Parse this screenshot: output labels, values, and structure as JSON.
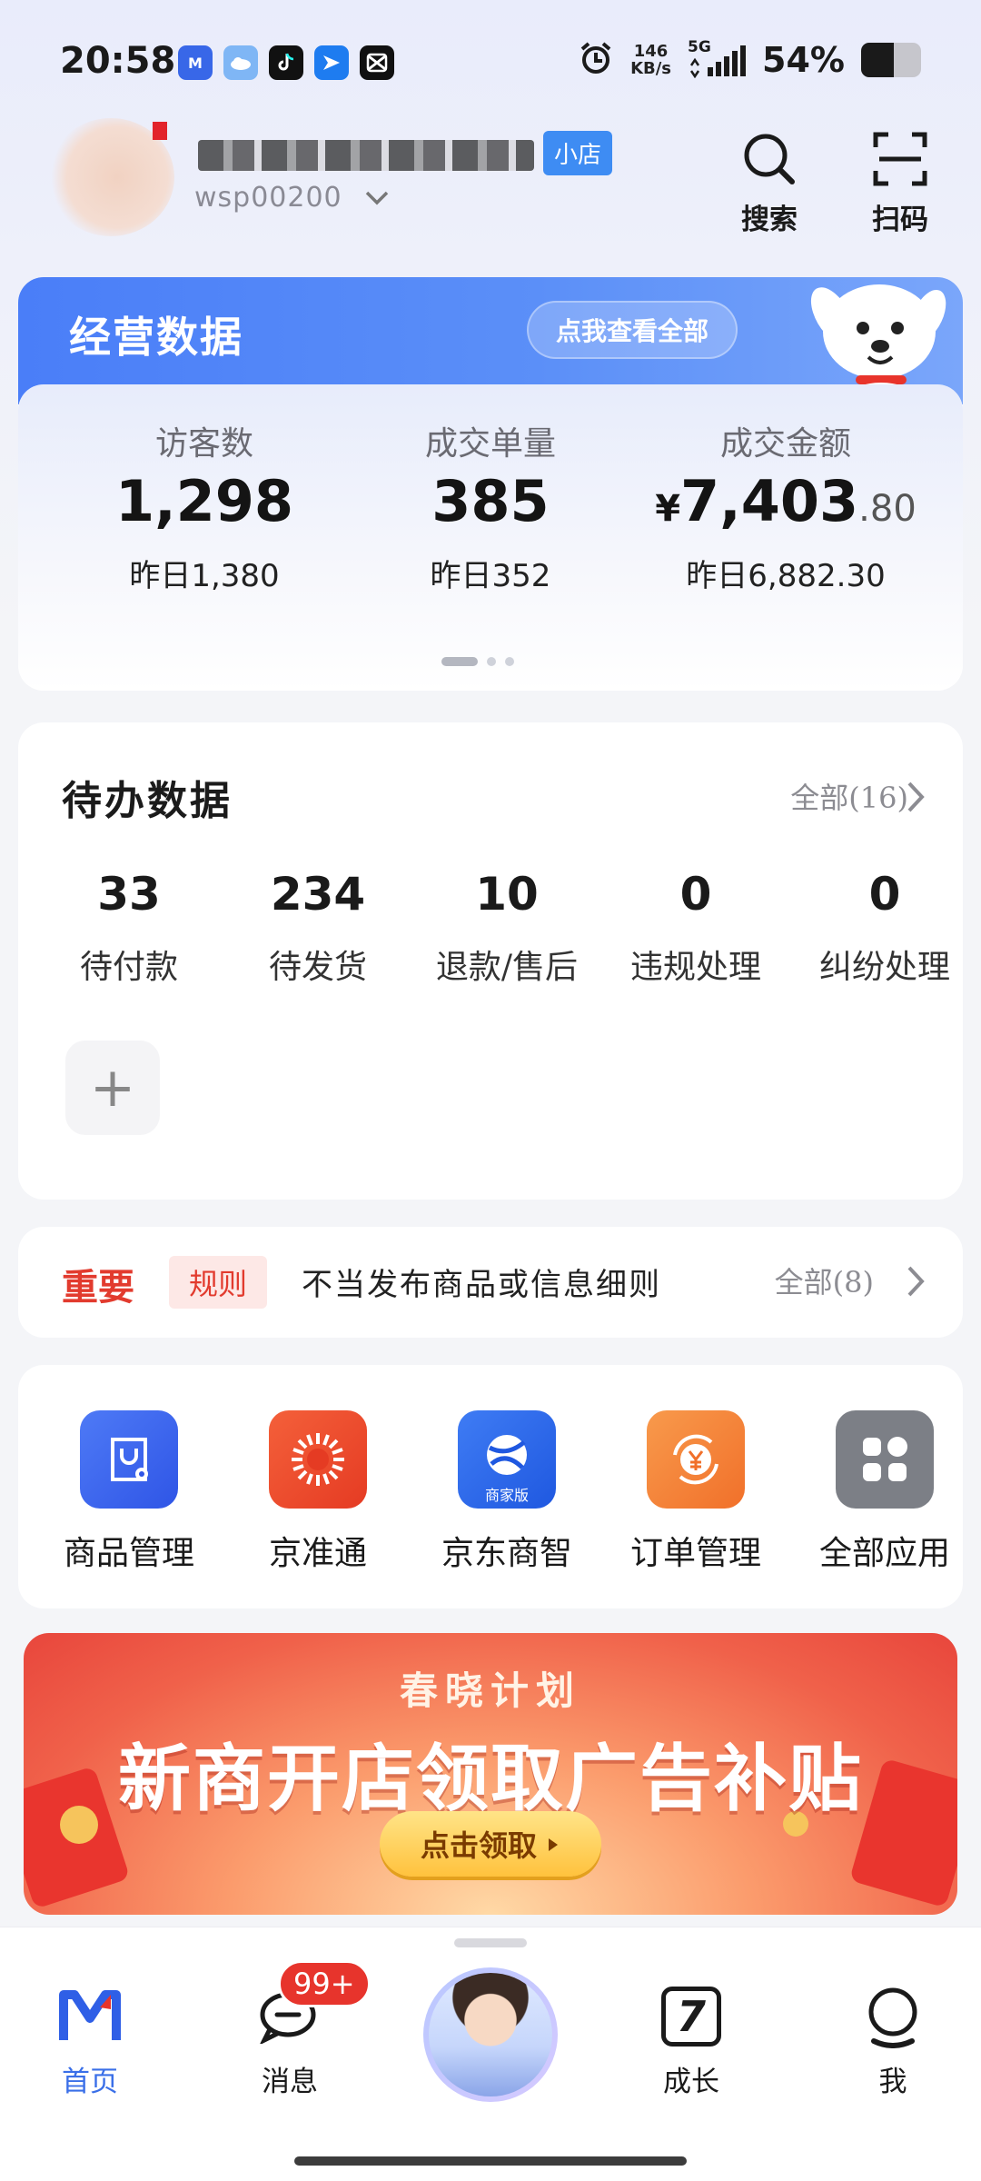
{
  "status_bar": {
    "time": "20:58",
    "net_speed_value": "146",
    "net_speed_unit": "KB/s",
    "network": "5G",
    "battery_text": "54%",
    "battery_level": 0.54,
    "app_icons": [
      "jd-merchant-icon",
      "weather-icon",
      "tiktok-icon",
      "feishu-icon",
      "capcut-icon"
    ],
    "app_icon_text": "M"
  },
  "header": {
    "shop_tag": "小店",
    "account": "wsp00200",
    "search_label": "搜索",
    "scan_label": "扫码"
  },
  "ops_card": {
    "title": "经营数据",
    "link_label": "点我查看全部",
    "stats": [
      {
        "label": "访客数",
        "value": "1,298",
        "prev": "昨日1,380"
      },
      {
        "label": "成交单量",
        "value": "385",
        "prev": "昨日352"
      },
      {
        "label": "成交金额",
        "currency": "¥",
        "value": "7,403",
        "decimal": ".80",
        "prev": "昨日6,882.30"
      }
    ],
    "pager": {
      "total": 3,
      "active": 0
    }
  },
  "todo": {
    "title": "待办数据",
    "all_label": "全部(16)",
    "items": [
      {
        "num": "33",
        "label": "待付款"
      },
      {
        "num": "234",
        "label": "待发货"
      },
      {
        "num": "10",
        "label": "退款/售后"
      },
      {
        "num": "0",
        "label": "违规处理"
      },
      {
        "num": "0",
        "label": "纠纷处理"
      }
    ],
    "add_symbol": "+"
  },
  "notice": {
    "important": "重要",
    "tag": "规则",
    "text": "不当发布商品或信息细则",
    "all_label": "全部(8)"
  },
  "apps": {
    "items": [
      {
        "label": "商品管理",
        "icon": "product-bag-icon",
        "color": "#3a66f0"
      },
      {
        "label": "京准通",
        "icon": "sunburst-icon",
        "color": "#ef4a2a"
      },
      {
        "label": "京东商智",
        "icon": "globe-icon",
        "color": "#2e6ff0",
        "sub": "商家版"
      },
      {
        "label": "订单管理",
        "icon": "order-yuan-icon",
        "color": "#f5813a"
      },
      {
        "label": "全部应用",
        "icon": "grid-icon",
        "color": "#7c7f86"
      }
    ]
  },
  "banner": {
    "subtitle": "春晓计划",
    "title": "新商开店领取广告补贴",
    "button": "点击领取"
  },
  "bottom_nav": {
    "items": [
      {
        "label": "首页",
        "icon": "home-m-icon",
        "active": true
      },
      {
        "label": "消息",
        "icon": "message-icon",
        "badge": "99+"
      },
      {
        "label": "",
        "icon": "assistant-avatar"
      },
      {
        "label": "成长",
        "icon": "growth-7-icon",
        "glyph": "7"
      },
      {
        "label": "我",
        "icon": "profile-icon"
      }
    ]
  },
  "colors": {
    "accent_blue": "#4a7ef8",
    "danger_red": "#e23b2e",
    "nav_active": "#3a6fe8"
  }
}
